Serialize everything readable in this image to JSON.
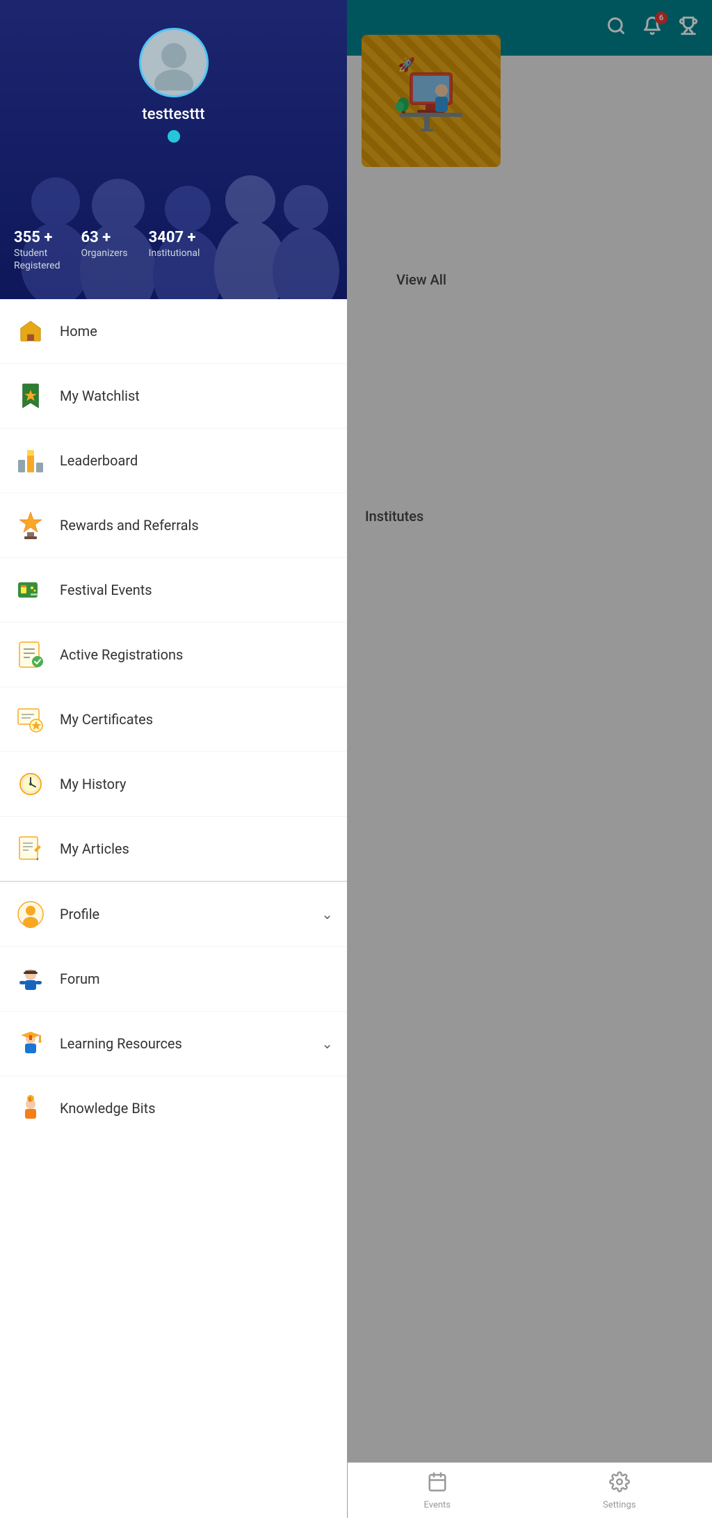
{
  "header": {
    "notif_count": "6",
    "bg_color": "#00838f"
  },
  "drawer": {
    "username": "testtesttt",
    "stats": [
      {
        "number": "355 +",
        "label1": "Student",
        "label2": "Registered"
      },
      {
        "number": "63 +",
        "label1": "Organizers",
        "label2": ""
      },
      {
        "number": "3407 +",
        "label1": "Institutional",
        "label2": ""
      }
    ],
    "menu_items": [
      {
        "id": "home",
        "label": "Home",
        "icon": "🏠",
        "has_chevron": false
      },
      {
        "id": "watchlist",
        "label": "My Watchlist",
        "icon": "🔖",
        "has_chevron": false
      },
      {
        "id": "leaderboard",
        "label": "Leaderboard",
        "icon": "🏆",
        "has_chevron": false
      },
      {
        "id": "rewards",
        "label": "Rewards and Referrals",
        "icon": "🏅",
        "has_chevron": false
      },
      {
        "id": "festival",
        "label": "Festival Events",
        "icon": "🎟️",
        "has_chevron": false
      },
      {
        "id": "registrations",
        "label": "Active Registrations",
        "icon": "📋",
        "has_chevron": false
      },
      {
        "id": "certificates",
        "label": "My Certificates",
        "icon": "📜",
        "has_chevron": false
      },
      {
        "id": "history",
        "label": "My History",
        "icon": "🕐",
        "has_chevron": false
      },
      {
        "id": "articles",
        "label": "My Articles",
        "icon": "✏️",
        "has_chevron": false
      },
      {
        "id": "profile",
        "label": "Profile",
        "icon": "👤",
        "has_chevron": true
      },
      {
        "id": "forum",
        "label": "Forum",
        "icon": "🧑‍💼",
        "has_chevron": false
      },
      {
        "id": "learning",
        "label": "Learning Resources",
        "icon": "🎓",
        "has_chevron": true
      },
      {
        "id": "knowledge",
        "label": "Knowledge Bits",
        "icon": "💡",
        "has_chevron": false
      }
    ]
  },
  "right_panel": {
    "view_all": "View All",
    "institutes": "Institutes"
  },
  "bottom_nav": [
    {
      "id": "events",
      "label": "Events",
      "icon": "📅"
    },
    {
      "id": "settings",
      "label": "Settings",
      "icon": "⚙️"
    }
  ]
}
